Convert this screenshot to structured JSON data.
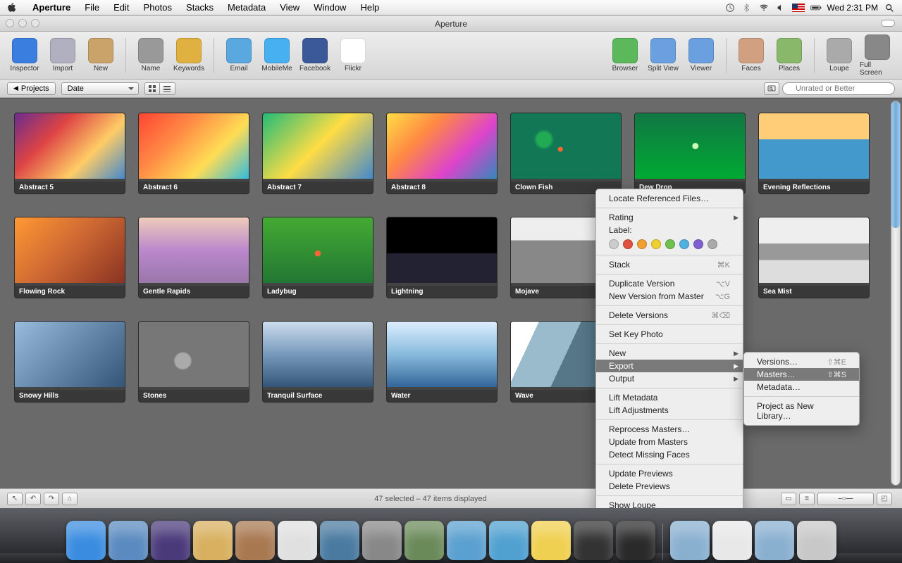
{
  "menubar": {
    "app": "Aperture",
    "items": [
      "File",
      "Edit",
      "Photos",
      "Stacks",
      "Metadata",
      "View",
      "Window",
      "Help"
    ],
    "clock": "Wed 2:31 PM"
  },
  "window": {
    "title": "Aperture"
  },
  "toolbar": {
    "left": [
      {
        "label": "Inspector",
        "color": "#3a7fe0"
      },
      {
        "label": "Import",
        "color": "#b0b0c0"
      },
      {
        "label": "New",
        "color": "#c9a36a"
      }
    ],
    "group2": [
      {
        "label": "Name",
        "color": "#999"
      },
      {
        "label": "Keywords",
        "color": "#e0b040"
      }
    ],
    "group3": [
      {
        "label": "Email",
        "color": "#5aa8e0"
      },
      {
        "label": "MobileMe",
        "color": "#46b0f0"
      },
      {
        "label": "Facebook",
        "color": "#3b5998"
      },
      {
        "label": "Flickr",
        "color": "#fff"
      }
    ],
    "right": [
      {
        "label": "Browser",
        "color": "#5bb85b"
      },
      {
        "label": "Split View",
        "color": "#6aa0e0"
      },
      {
        "label": "Viewer",
        "color": "#6aa0e0"
      }
    ],
    "right2": [
      {
        "label": "Faces",
        "color": "#d0a080"
      },
      {
        "label": "Places",
        "color": "#8ab86a"
      }
    ],
    "right3": [
      {
        "label": "Loupe",
        "color": "#aaa"
      },
      {
        "label": "Full Screen",
        "color": "#888"
      }
    ]
  },
  "filterbar": {
    "back": "Projects",
    "sort": "Date",
    "search_placeholder": "Unrated or Better"
  },
  "thumbs": [
    {
      "label": "Abstract 5",
      "cls": "g-a5"
    },
    {
      "label": "Abstract 6",
      "cls": "g-a6"
    },
    {
      "label": "Abstract 7",
      "cls": "g-a7"
    },
    {
      "label": "Abstract 8",
      "cls": "g-a8"
    },
    {
      "label": "Clown Fish",
      "cls": "g-cf"
    },
    {
      "label": "Dew Drop",
      "cls": "g-dd"
    },
    {
      "label": "Evening Reflections",
      "cls": "g-er"
    },
    {
      "label": "Flowing Rock",
      "cls": "g-fr"
    },
    {
      "label": "Gentle Rapids",
      "cls": "g-gr"
    },
    {
      "label": "Ladybug",
      "cls": "g-lb"
    },
    {
      "label": "Lightning",
      "cls": "g-lt"
    },
    {
      "label": "Mojave",
      "cls": "g-mj"
    },
    {
      "label": "",
      "cls": ""
    },
    {
      "label": "Sea Mist",
      "cls": "g-sm"
    },
    {
      "label": "Snowy Hills",
      "cls": "g-sh"
    },
    {
      "label": "Stones",
      "cls": "g-st"
    },
    {
      "label": "Tranquil Surface",
      "cls": "g-ts"
    },
    {
      "label": "Water",
      "cls": "g-wa"
    },
    {
      "label": "Wave",
      "cls": "g-wv"
    }
  ],
  "status": {
    "text": "47 selected – 47 items displayed"
  },
  "ctx1": {
    "locate": "Locate Referenced Files…",
    "rating": "Rating",
    "label": "Label:",
    "label_colors": [
      "#ccc",
      "#e05040",
      "#f0a030",
      "#f0d030",
      "#70c050",
      "#50b0e0",
      "#8060d0",
      "#aaa"
    ],
    "stack": "Stack",
    "stack_sc": "⌘K",
    "dup": "Duplicate Version",
    "dup_sc": "⌥V",
    "newv": "New Version from Master",
    "newv_sc": "⌥G",
    "del": "Delete Versions",
    "del_sc": "⌘⌫",
    "key": "Set Key Photo",
    "new": "New",
    "export": "Export",
    "output": "Output",
    "liftm": "Lift Metadata",
    "lifta": "Lift Adjustments",
    "rep": "Reprocess Masters…",
    "upd": "Update from Masters",
    "det": "Detect Missing Faces",
    "updp": "Update Previews",
    "delp": "Delete Previews",
    "loupe": "Show Loupe"
  },
  "ctx2": {
    "versions": "Versions…",
    "versions_sc": "⇧⌘E",
    "masters": "Masters…",
    "masters_sc": "⇧⌘S",
    "metadata": "Metadata…",
    "project": "Project as New Library…"
  },
  "dock": {
    "items": [
      {
        "name": "finder",
        "color": "#3a8ce0"
      },
      {
        "name": "appstore",
        "color": "#5a8ac0"
      },
      {
        "name": "eclipse",
        "color": "#4a3a7a"
      },
      {
        "name": "mail",
        "color": "#d8b060"
      },
      {
        "name": "contacts",
        "color": "#a87850"
      },
      {
        "name": "ical",
        "color": "#e0e0e0"
      },
      {
        "name": "preview",
        "color": "#4a7aa0"
      },
      {
        "name": "sysprefs",
        "color": "#888"
      },
      {
        "name": "timemachine",
        "color": "#6a8a5a"
      },
      {
        "name": "safari",
        "color": "#5aa0d0"
      },
      {
        "name": "xcode",
        "color": "#50a0d0"
      },
      {
        "name": "chrome",
        "color": "#f0d050"
      },
      {
        "name": "terminal",
        "color": "#333"
      },
      {
        "name": "aperture",
        "color": "#2a2a2a"
      }
    ],
    "right": [
      {
        "name": "folder",
        "color": "#8ab0d0"
      },
      {
        "name": "documents",
        "color": "#e8e8e8"
      },
      {
        "name": "downloads",
        "color": "#8ab0d0"
      },
      {
        "name": "trash",
        "color": "#c8c8c8"
      }
    ]
  }
}
